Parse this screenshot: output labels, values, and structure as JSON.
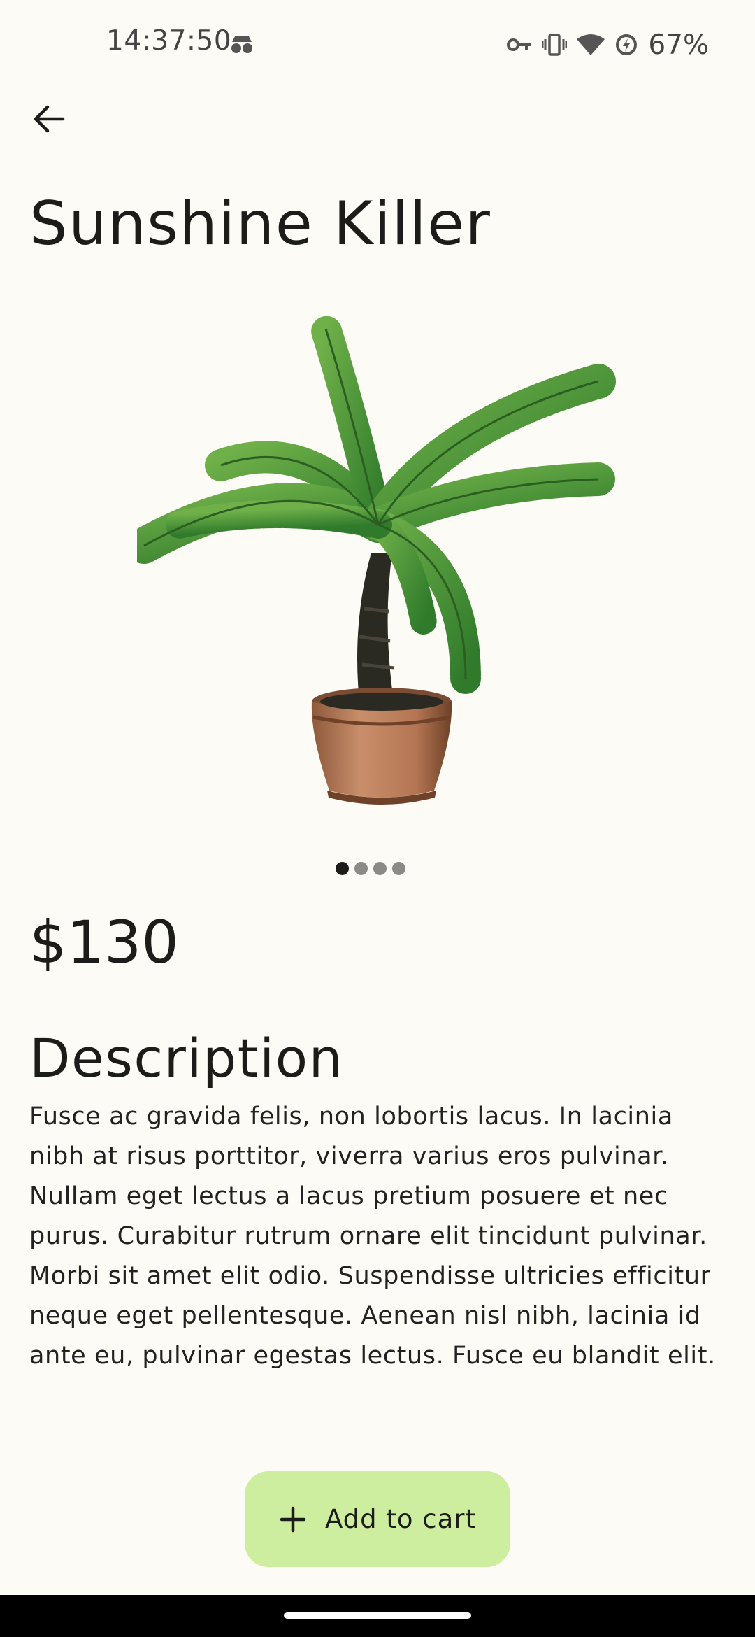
{
  "status_bar": {
    "time": "14:37:50",
    "battery_percent": "67%",
    "icons": [
      "incognito-icon",
      "vpn-key-icon",
      "vibrate-icon",
      "wifi-icon",
      "data-saver-icon"
    ]
  },
  "header": {
    "back_icon": "arrow-left-icon"
  },
  "product": {
    "title": "Sunshine Killer",
    "image": "potted-fern-plant",
    "carousel": {
      "total": 4,
      "active_index": 0
    },
    "price": "$130",
    "description_heading": "Description",
    "description": "Fusce ac gravida felis, non lobortis lacus. In lacinia nibh at risus porttitor, viverra varius eros pulvinar. Nullam eget lectus a lacus pretium posuere et nec purus. Curabitur rutrum ornare elit tincidunt pulvinar. Morbi sit amet elit odio. Suspendisse ultricies efficitur neque eget pellentesque. Aenean nisl nibh, lacinia id ante eu, pulvinar egestas lectus. Fusce eu blandit elit."
  },
  "actions": {
    "add_to_cart_label": "Add to cart",
    "add_to_cart_icon": "plus-icon"
  },
  "colors": {
    "background": "#fcfbf5",
    "button": "#cdee9e",
    "text": "#1c1c1a"
  }
}
